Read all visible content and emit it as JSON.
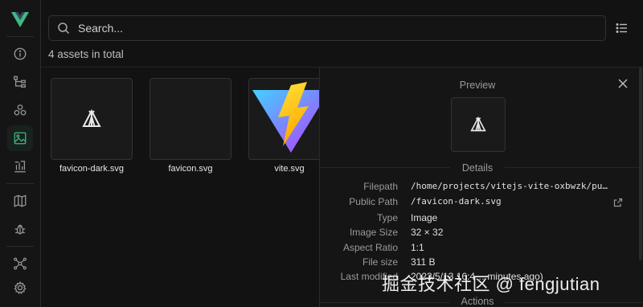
{
  "search": {
    "placeholder": "Search..."
  },
  "summary": "4 assets in total",
  "sidebar": {
    "items": [
      {
        "icon": "info-icon"
      },
      {
        "icon": "component-tree-icon"
      },
      {
        "icon": "components-icon"
      },
      {
        "icon": "assets-image-icon",
        "active": true
      },
      {
        "icon": "timeline-icon"
      },
      {
        "icon": "map-icon"
      },
      {
        "icon": "debug-bug-icon"
      },
      {
        "icon": "graph-icon"
      },
      {
        "icon": "settings-gear-icon"
      }
    ]
  },
  "assets": [
    {
      "name": "favicon-dark.svg",
      "preview": "tent-icon"
    },
    {
      "name": "favicon.svg",
      "preview": "empty"
    },
    {
      "name": "vite.svg",
      "preview": "vite-logo"
    }
  ],
  "panel": {
    "preview_title": "Preview",
    "details_title": "Details",
    "actions_title": "Actions",
    "details": [
      {
        "key": "Filepath",
        "value": "/home/projects/vitejs-vite-oxbwzk/pu…",
        "mono": true
      },
      {
        "key": "Public Path",
        "value": "/favicon-dark.svg",
        "mono": true,
        "external": true
      },
      {
        "key": "Type",
        "value": "Image"
      },
      {
        "key": "Image Size",
        "value": "32 × 32"
      },
      {
        "key": "Aspect Ratio",
        "value": "1:1"
      },
      {
        "key": "File size",
        "value": "311 B"
      },
      {
        "key": "Last modified",
        "value": "2023/5/13 16:4… minutes ago)"
      }
    ]
  },
  "watermark": "掘金技术社区 @ fengjutian",
  "colors": {
    "accent": "#42b883",
    "background": "#121212"
  }
}
